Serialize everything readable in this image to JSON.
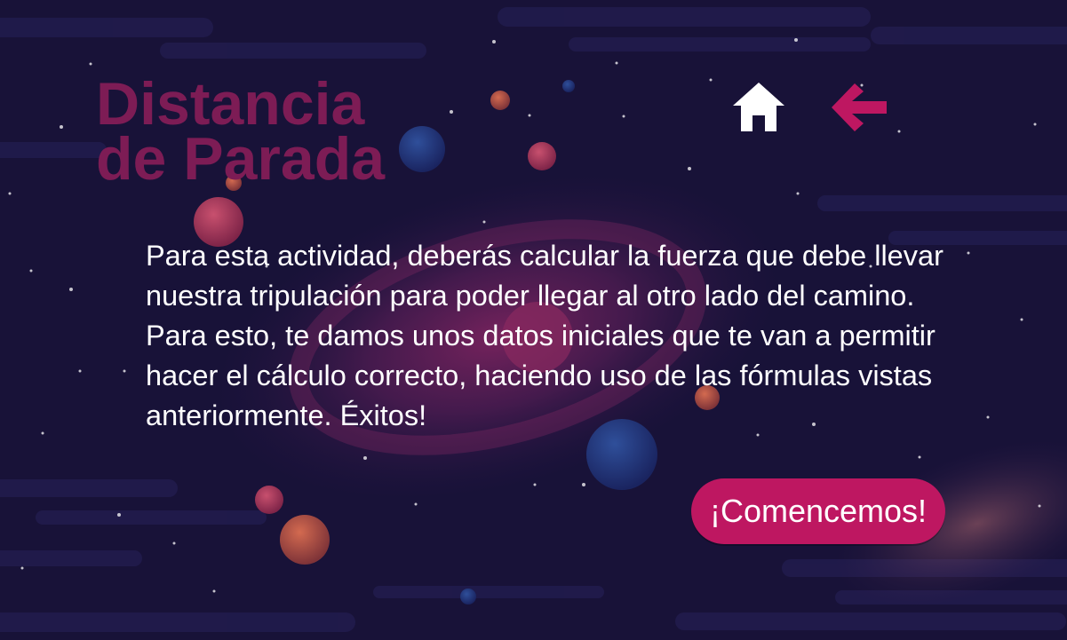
{
  "title": {
    "line1": "Distancia",
    "line2": "de Parada"
  },
  "nav": {
    "home_icon": "home-icon",
    "back_icon": "arrow-left-icon"
  },
  "description": "Para esta actividad, deberás calcular la fuerza que debe llevar nuestra tripulación para poder llegar al otro lado del camino. Para esto, te damos unos datos iniciales que te van a permitir hacer el cálculo correcto, haciendo uso de las fórmulas vistas anteriormente. Éxitos!",
  "start_button": {
    "label": "¡Comencemos!"
  },
  "colors": {
    "background": "#181238",
    "title": "#7d1c55",
    "accent": "#be1761",
    "text": "#ffffff"
  }
}
